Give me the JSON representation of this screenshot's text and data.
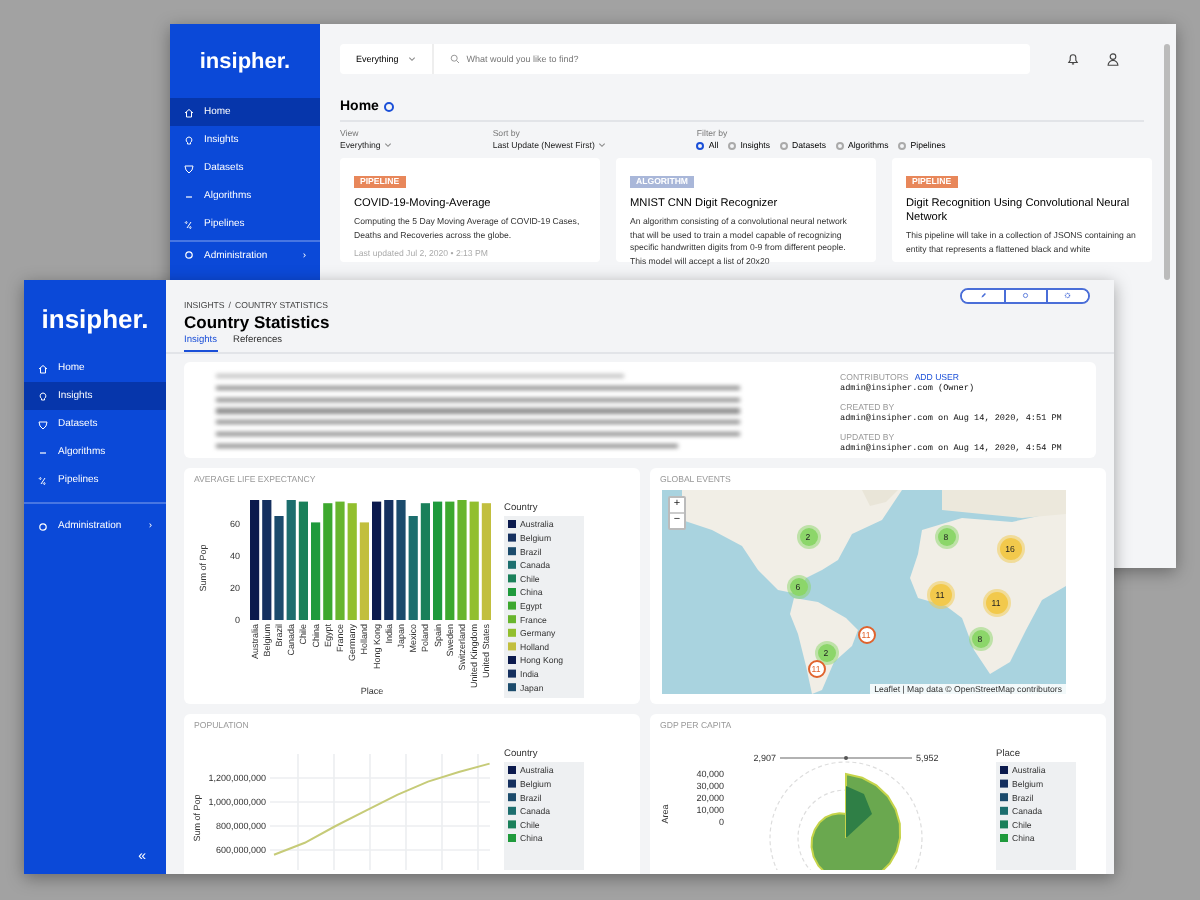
{
  "back_window": {
    "logo": "insipher.",
    "nav": [
      {
        "label": "Home",
        "kind": "home",
        "selected": true
      },
      {
        "label": "Insights",
        "kind": "insights",
        "selected": false
      },
      {
        "label": "Datasets",
        "kind": "datasets",
        "selected": false
      },
      {
        "label": "Algorithms",
        "kind": "algorithms",
        "selected": false
      },
      {
        "label": "Pipelines",
        "kind": "pipelines",
        "selected": false
      }
    ],
    "admin": {
      "label": "Administration",
      "chevron": "›"
    },
    "search": {
      "scope": "Everything",
      "placeholder": "What would you like to find?"
    },
    "page_title": "Home",
    "filters": {
      "view": {
        "label": "View",
        "value": "Everything"
      },
      "sort": {
        "label": "Sort by",
        "value": "Last Update (Newest First)"
      },
      "filter_label": "Filter by",
      "options": [
        {
          "label": "All",
          "selected": true
        },
        {
          "label": "Insights",
          "selected": false
        },
        {
          "label": "Datasets",
          "selected": false
        },
        {
          "label": "Algorithms",
          "selected": false
        },
        {
          "label": "Pipelines",
          "selected": false
        }
      ]
    },
    "cards": [
      {
        "kind": "pipeline",
        "tag": "PIPELINE",
        "title": "COVID-19-Moving-Average",
        "description": "Computing the 5 Day Moving Average of COVID-19 Cases, Deaths and Recoveries across the globe.",
        "updated": "Last updated Jul 2, 2020 • 2:13 PM"
      },
      {
        "kind": "algorithm",
        "tag": "ALGORITHM",
        "title": "MNIST CNN Digit Recognizer",
        "description": "An algorithm consisting of a convolutional neural network that will be used to train a model capable of recognizing specific handwritten digits from 0-9 from different people. This model will accept a list of 20x20"
      },
      {
        "kind": "pipeline",
        "tag": "PIPELINE",
        "title": "Digit Recognition Using Convolutional Neural Network",
        "description": "This pipeline will take in a collection of JSONS containing an entity that represents a flattened black and white"
      }
    ]
  },
  "front_window": {
    "logo": "insipher.",
    "nav": [
      {
        "label": "Home",
        "kind": "home",
        "selected": false
      },
      {
        "label": "Insights",
        "kind": "insights",
        "selected": true
      },
      {
        "label": "Datasets",
        "kind": "datasets",
        "selected": false
      },
      {
        "label": "Algorithms",
        "kind": "algorithms",
        "selected": false
      },
      {
        "label": "Pipelines",
        "kind": "pipelines",
        "selected": false
      }
    ],
    "admin": {
      "label": "Administration",
      "chevron": "›"
    },
    "collapse": "«",
    "breadcrumb": [
      "INSIGHTS",
      "COUNTRY STATISTICS"
    ],
    "breadcrumb_separator": "/",
    "title": "Country Statistics",
    "tabs": [
      {
        "label": "Insights",
        "selected": true
      },
      {
        "label": "References",
        "selected": false
      }
    ],
    "info": {
      "contributors_label": "CONTRIBUTORS",
      "add_user": "ADD USER",
      "contributor": "admin@insipher.com (Owner)",
      "created_label": "CREATED BY",
      "created": "admin@insipher.com on Aug 14, 2020, 4:51 PM",
      "updated_label": "UPDATED BY",
      "updated": "admin@insipher.com on Aug 14, 2020, 4:54 PM"
    },
    "life_expectancy": {
      "title": "AVERAGE LIFE EXPECTANCY",
      "chart_data": {
        "type": "bar",
        "xlabel": "Place",
        "ylabel": "Sum of Pop",
        "ylim": [
          0,
          80
        ],
        "yticks": [
          0,
          20,
          40,
          60
        ],
        "categories": [
          "Australia",
          "Belgium",
          "Brazil",
          "Canada",
          "Chile",
          "China",
          "Egypt",
          "France",
          "Germany",
          "Holland",
          "Hong Kong",
          "India",
          "Japan",
          "Mexico",
          "Poland",
          "Spain",
          "Sweden",
          "Switzerland",
          "United Kingdom",
          "United States"
        ],
        "series": [
          {
            "values": [
              75,
              75,
              65,
              75,
              74,
              61,
              73,
              74,
              73,
              61,
              74,
              75,
              75,
              65,
              73,
              74,
              74,
              75,
              74,
              73
            ]
          }
        ]
      },
      "legend_title": "Country",
      "legend": [
        {
          "label": "Australia",
          "color": "#0b1a4d"
        },
        {
          "label": "Belgium",
          "color": "#15305f"
        },
        {
          "label": "Brazil",
          "color": "#1b4b6c"
        },
        {
          "label": "Canada",
          "color": "#1c6e6e"
        },
        {
          "label": "Chile",
          "color": "#1a805a"
        },
        {
          "label": "China",
          "color": "#1f9a3c"
        },
        {
          "label": "Egypt",
          "color": "#3da82e"
        },
        {
          "label": "France",
          "color": "#68b52d"
        },
        {
          "label": "Germany",
          "color": "#92bf2e"
        },
        {
          "label": "Holland",
          "color": "#c2bf3e"
        },
        {
          "label": "Hong Kong",
          "color": "#0b1a4d"
        },
        {
          "label": "India",
          "color": "#15305f"
        },
        {
          "label": "Japan",
          "color": "#1b4b6c"
        }
      ]
    },
    "global_events": {
      "title": "GLOBAL EVENTS",
      "zoom_in": "+",
      "zoom_out": "−",
      "attribution": "Leaflet | Map data © OpenStreetMap contributors",
      "markers": [
        {
          "count": "2",
          "kind": "small"
        },
        {
          "count": "8",
          "kind": "small"
        },
        {
          "count": "16",
          "kind": "medium"
        },
        {
          "count": "6",
          "kind": "small"
        },
        {
          "count": "11",
          "kind": "medium"
        },
        {
          "count": "11",
          "kind": "medium"
        },
        {
          "count": "2",
          "kind": "small"
        },
        {
          "count": "8",
          "kind": "small"
        },
        {
          "count": "11",
          "kind": "pin"
        },
        {
          "count": "11",
          "kind": "pin"
        }
      ]
    },
    "population": {
      "title": "POPULATION",
      "chart_data": {
        "type": "line",
        "ylabel": "Sum of Pop",
        "grid": true,
        "ylim": [
          400000000,
          1400000000
        ],
        "yticks": [
          {
            "value": 600000000,
            "label": "600,000,000"
          },
          {
            "value": 800000000,
            "label": "800,000,000"
          },
          {
            "value": 1000000000,
            "label": "1,000,000,000"
          },
          {
            "value": 1200000000,
            "label": "1,200,000,000"
          }
        ],
        "series": [
          {
            "color": "#c6cb78",
            "values": [
              560000000,
              660000000,
              800000000,
              930000000,
              1060000000,
              1170000000,
              1250000000,
              1320000000
            ]
          }
        ]
      },
      "legend_title": "Country",
      "legend": [
        {
          "label": "Australia",
          "color": "#0b1a4d"
        },
        {
          "label": "Belgium",
          "color": "#15305f"
        },
        {
          "label": "Brazil",
          "color": "#1b4b6c"
        },
        {
          "label": "Canada",
          "color": "#1c6e6e"
        },
        {
          "label": "Chile",
          "color": "#1a805a"
        },
        {
          "label": "China",
          "color": "#1f9a3c"
        }
      ]
    },
    "gdp": {
      "title": "GDP PER CAPITA",
      "ylabel": "Area",
      "ticks": [
        "40,000",
        "30,000",
        "20,000",
        "10,000",
        "0"
      ],
      "range_low": "2,907",
      "range_high": "5,952",
      "legend_title": "Place",
      "legend": [
        {
          "label": "Australia",
          "color": "#0b1a4d"
        },
        {
          "label": "Belgium",
          "color": "#15305f"
        },
        {
          "label": "Brazil",
          "color": "#1b4b6c"
        },
        {
          "label": "Canada",
          "color": "#1c6e6e"
        },
        {
          "label": "Chile",
          "color": "#1a805a"
        },
        {
          "label": "China",
          "color": "#1f9a3c"
        }
      ]
    }
  }
}
